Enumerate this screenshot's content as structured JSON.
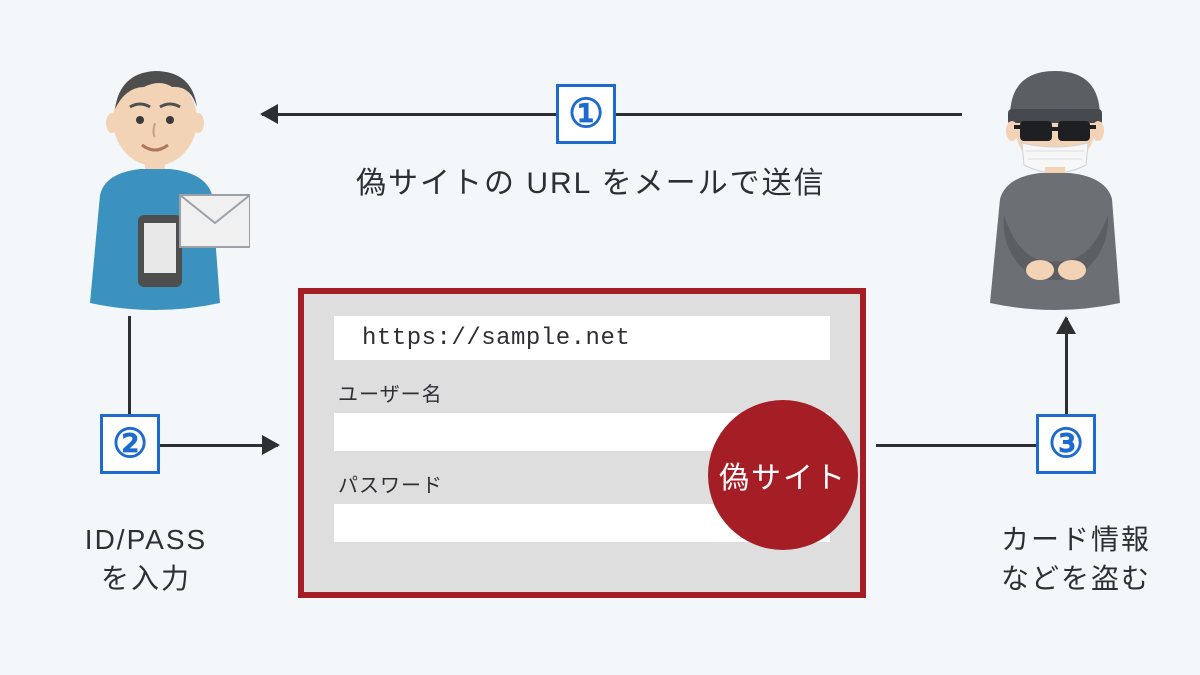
{
  "step1": {
    "number": "①",
    "label": "偽サイトの URL をメールで送信"
  },
  "step2": {
    "number": "②",
    "label_line1": "ID/PASS",
    "label_line2": "を入力"
  },
  "step3": {
    "number": "③",
    "label_line1": "カード情報",
    "label_line2": "などを盗む"
  },
  "fake_site": {
    "url": "https://sample.net",
    "username_label": "ユーザー名",
    "password_label": "パスワード",
    "badge": "偽サイト"
  },
  "colors": {
    "accent_blue": "#1e6bcf",
    "danger_red": "#a51e25",
    "page_bg": "#f3f7f9",
    "card_bg": "#dedede"
  }
}
